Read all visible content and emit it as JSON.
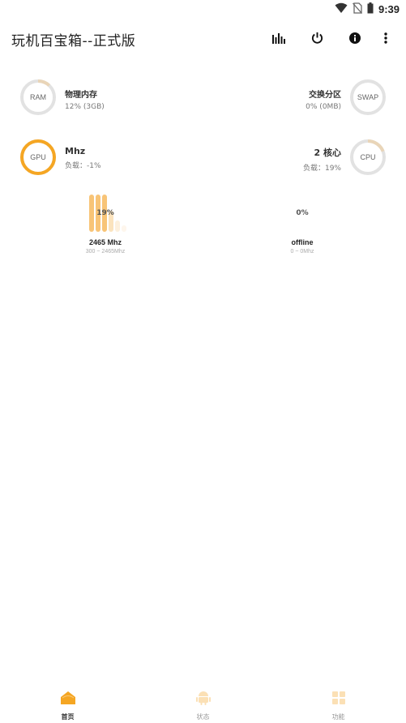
{
  "status_bar": {
    "time": "9:39"
  },
  "app_bar": {
    "title": "玩机百宝箱--正式版",
    "actions": [
      "chart-icon",
      "power-icon",
      "info-icon",
      "more-vert-icon"
    ]
  },
  "colors": {
    "accent": "#F5A623",
    "ring_bg": "#E2E2E2",
    "ring_fill_light": "#E9D5B8",
    "bar_color": "#F8C477"
  },
  "ram": {
    "label": "RAM",
    "title": "物理内存",
    "value": "12% (3GB)",
    "usage": 0.12
  },
  "swap": {
    "label": "SWAP",
    "title": "交换分区",
    "value": "0% (0MB)",
    "usage": 0.0
  },
  "gpu": {
    "label": "GPU",
    "title": "Mhz",
    "load": "负载：-1%",
    "usage": 1.0
  },
  "cpu": {
    "label": "CPU",
    "title": "2 核心",
    "load": "负载：19%",
    "usage": 0.19
  },
  "cores": [
    {
      "percent": "19%",
      "freq": "2465 Mhz",
      "range": "300 ~ 2465Mhz"
    },
    {
      "percent": "0%",
      "freq": "offline",
      "range": "0 ~ 0Mhz"
    }
  ],
  "bottom_nav": [
    {
      "label": "首页",
      "icon": "home-icon",
      "active": true
    },
    {
      "label": "状态",
      "icon": "android-icon",
      "active": false
    },
    {
      "label": "功能",
      "icon": "grid-icon",
      "active": false
    }
  ]
}
